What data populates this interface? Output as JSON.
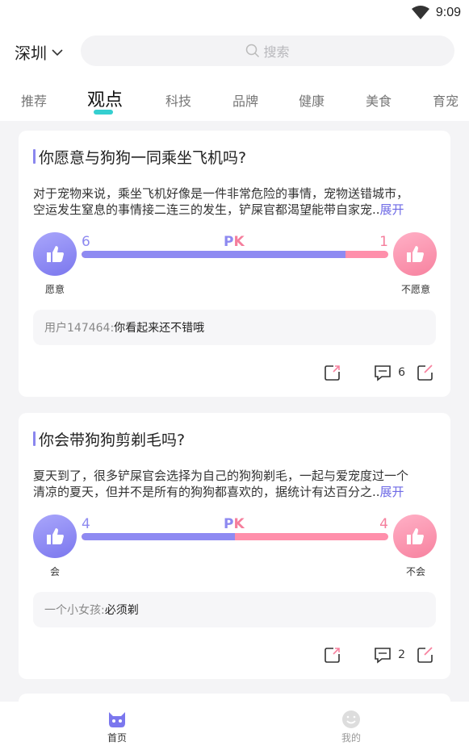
{
  "status": {
    "time": "9:09"
  },
  "header": {
    "city": "深圳",
    "search_placeholder": "搜索"
  },
  "tabs": [
    {
      "label": "推荐"
    },
    {
      "label": "观点"
    },
    {
      "label": "科技"
    },
    {
      "label": "品牌"
    },
    {
      "label": "健康"
    },
    {
      "label": "美食"
    },
    {
      "label": "育宠"
    }
  ],
  "active_tab": "观点",
  "posts": [
    {
      "title": "你愿意与狗狗一同乘坐飞机吗?",
      "desc_line1": "对于宠物来说，乘坐飞机好像是一件非常危险的事情，宠物送错城市，",
      "desc_line2": "空运发生窒息的事情接二连三的发生，铲屎官都渴望能带自家宠..",
      "expand_label": "展开",
      "pk_p": "P",
      "pk_k": "K",
      "left_count": "6",
      "right_count": "1",
      "left_option": "愿意",
      "right_option": "不愿意",
      "left_share": 0.86,
      "comment_user": "用户147464:",
      "comment_text": "你看起来还不错哦",
      "comment_count": "6"
    },
    {
      "title": "你会带狗狗剪剃毛吗?",
      "desc_line1": "夏天到了，很多铲屎官会选择为自己的狗狗剃毛，一起与爱宠度过一个",
      "desc_line2": "清凉的夏天，但并不是所有的狗狗都喜欢的，据统计有达百分之..",
      "expand_label": "展开",
      "pk_p": "P",
      "pk_k": "K",
      "left_count": "4",
      "right_count": "4",
      "left_option": "会",
      "right_option": "不会",
      "left_share": 0.5,
      "comment_user": "一个小女孩:",
      "comment_text": "必须剃",
      "comment_count": "2"
    }
  ],
  "bottom_nav": [
    {
      "label": "首页",
      "color": "#333333"
    },
    {
      "label": "我的",
      "color": "#999999"
    }
  ],
  "colors": {
    "accent_purple": "#8e8af2",
    "accent_pink": "#ff8fab",
    "tab_indicator": "#35cfd0"
  }
}
